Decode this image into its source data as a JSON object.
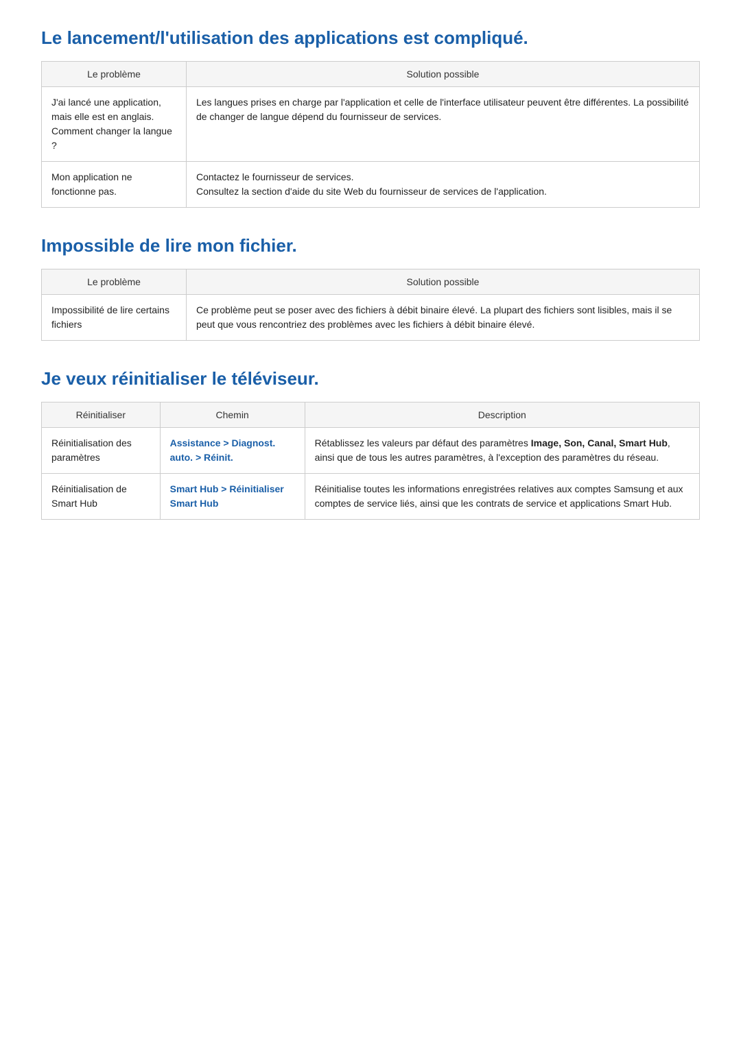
{
  "section1": {
    "title": "Le lancement/l'utilisation des applications est compliqué.",
    "table": {
      "col1_header": "Le problème",
      "col2_header": "Solution possible",
      "rows": [
        {
          "problem": "J'ai lancé une application, mais elle est en anglais. Comment changer la langue ?",
          "solution": "Les langues prises en charge par l'application et celle de l'interface utilisateur peuvent être différentes. La possibilité de changer de langue dépend du fournisseur de services."
        },
        {
          "problem": "Mon application ne fonctionne pas.",
          "solution_line1": "Contactez le fournisseur de services.",
          "solution_line2": "Consultez la section d'aide du site Web du fournisseur de services de l'application."
        }
      ]
    }
  },
  "section2": {
    "title": "Impossible de lire mon fichier.",
    "table": {
      "col1_header": "Le problème",
      "col2_header": "Solution possible",
      "rows": [
        {
          "problem": "Impossibilité de lire certains fichiers",
          "solution": "Ce problème peut se poser avec des fichiers à débit binaire élevé. La plupart des fichiers sont lisibles, mais il se peut que vous rencontriez des problèmes avec les fichiers à débit binaire élevé."
        }
      ]
    }
  },
  "section3": {
    "title": "Je veux réinitialiser le téléviseur.",
    "table": {
      "col1_header": "Réinitialiser",
      "col2_header": "Chemin",
      "col3_header": "Description",
      "rows": [
        {
          "reinit": "Réinitialisation des paramètres",
          "chemin": "Assistance > Diagnost. auto. > Réinit.",
          "description_before": "Rétablissez les valeurs par défaut des paramètres ",
          "description_bold": "Image, Son, Canal, Smart Hub",
          "description_after": ", ainsi que de tous les autres paramètres, à l'exception des paramètres du réseau."
        },
        {
          "reinit": "Réinitialisation de Smart Hub",
          "chemin": "Smart Hub > Réinitialiser Smart Hub",
          "description": "Réinitialise toutes les informations enregistrées relatives aux comptes Samsung et aux comptes de service liés, ainsi que les contrats de service et applications Smart Hub."
        }
      ]
    }
  }
}
